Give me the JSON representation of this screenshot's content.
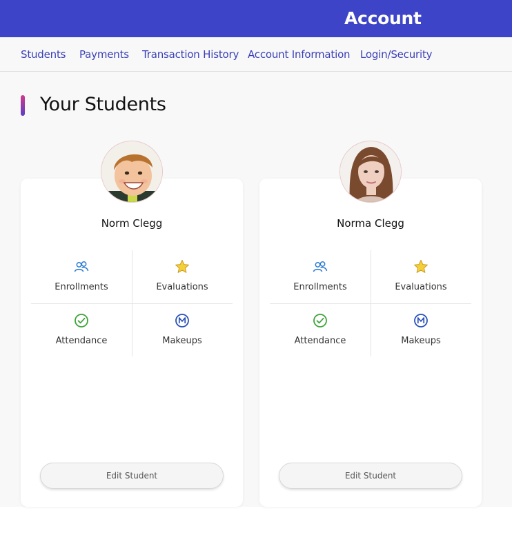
{
  "header": {
    "title": "Account"
  },
  "nav": {
    "items": [
      "Students",
      "Payments",
      "Transaction History",
      "Account Information",
      "Login/Security"
    ]
  },
  "page": {
    "heading": "Your Students"
  },
  "students": [
    {
      "name": "Norm Clegg",
      "actions": {
        "enrollments": "Enrollments",
        "evaluations": "Evaluations",
        "attendance": "Attendance",
        "makeups": "Makeups"
      },
      "edit_label": "Edit Student"
    },
    {
      "name": "Norma Clegg",
      "actions": {
        "enrollments": "Enrollments",
        "evaluations": "Evaluations",
        "attendance": "Attendance",
        "makeups": "Makeups"
      },
      "edit_label": "Edit Student"
    }
  ],
  "icons": {
    "enrollments": "people-icon",
    "evaluations": "star-icon",
    "attendance": "checkmark-circle-icon",
    "makeups": "m-circle-icon"
  },
  "colors": {
    "header_bg": "#3d44c8",
    "nav_link": "#3b40b8",
    "people_icon": "#2a7ad1",
    "star_fill": "#f5cf3a",
    "check_green": "#3fa33a",
    "makeup_blue": "#2850b8"
  }
}
